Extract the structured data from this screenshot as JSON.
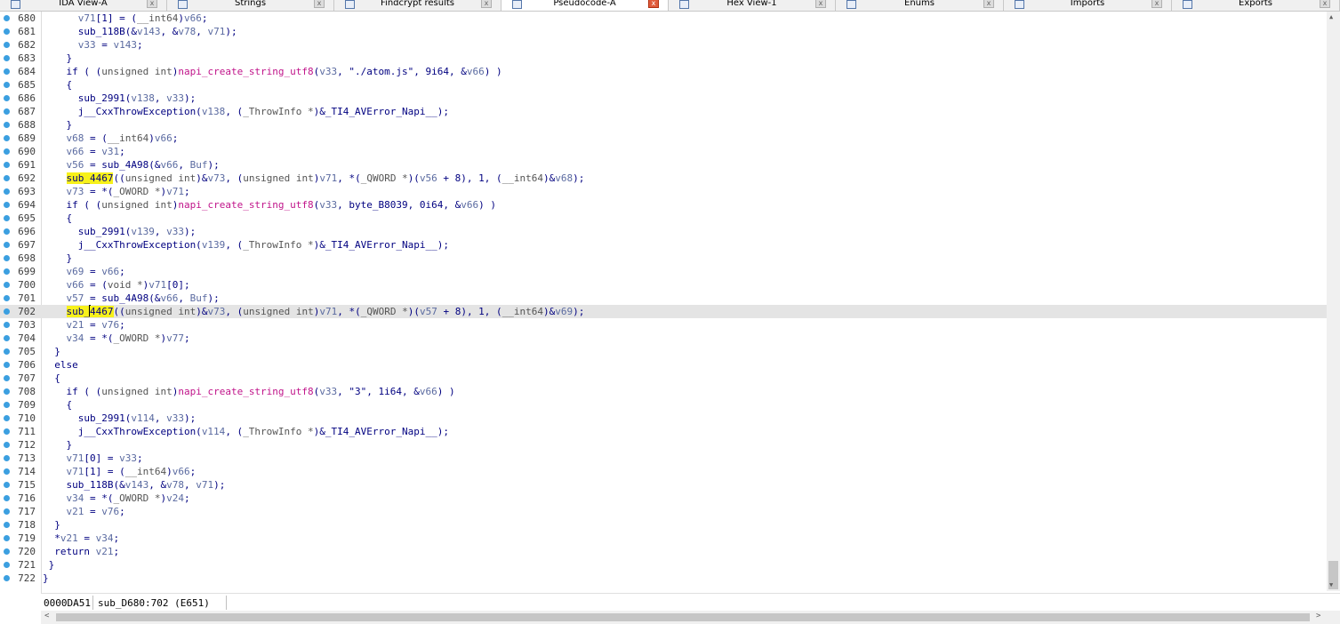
{
  "tabs": [
    {
      "label": "IDA View-A",
      "width": 188,
      "active": false,
      "icon": "disassembly-icon"
    },
    {
      "label": "Strings",
      "width": 188,
      "active": false,
      "icon": "strings-icon"
    },
    {
      "label": "Findcrypt results",
      "width": 188,
      "active": false,
      "icon": "findcrypt-icon"
    },
    {
      "label": "Pseudocode-A",
      "width": 188,
      "active": true,
      "icon": "pseudocode-icon"
    },
    {
      "label": "Hex View-1",
      "width": 188,
      "active": false,
      "icon": "hex-view-icon"
    },
    {
      "label": "Enums",
      "width": 189,
      "active": false,
      "icon": "enums-icon"
    },
    {
      "label": "Imports",
      "width": 189,
      "active": false,
      "icon": "imports-icon"
    },
    {
      "label": "Exports",
      "width": 189,
      "active": false,
      "icon": "exports-icon"
    }
  ],
  "close_glyph": "x",
  "code_lines": [
    {
      "n": "680",
      "s": [
        [
          "      ",
          ""
        ],
        [
          "v71",
          "var"
        ],
        [
          "[1] = (",
          ""
        ],
        [
          "__int64",
          "ty"
        ],
        [
          ")",
          ""
        ],
        [
          "v66",
          "var"
        ],
        [
          ";",
          ""
        ]
      ]
    },
    {
      "n": "681",
      "s": [
        [
          "      sub_118B(&",
          ""
        ],
        [
          "v143",
          "var"
        ],
        [
          ", &",
          ""
        ],
        [
          "v78",
          "var"
        ],
        [
          ", ",
          ""
        ],
        [
          "v71",
          "var"
        ],
        [
          ");",
          ""
        ]
      ]
    },
    {
      "n": "682",
      "s": [
        [
          "      ",
          ""
        ],
        [
          "v33",
          "var"
        ],
        [
          " = ",
          ""
        ],
        [
          "v143",
          "var"
        ],
        [
          ";",
          ""
        ]
      ]
    },
    {
      "n": "683",
      "s": [
        [
          "    }",
          ""
        ]
      ]
    },
    {
      "n": "684",
      "s": [
        [
          "    if ( (",
          ""
        ],
        [
          "unsigned int",
          "ty"
        ],
        [
          ")",
          ""
        ],
        [
          "napi_create_string_utf8",
          "fn"
        ],
        [
          "(",
          ""
        ],
        [
          "v33",
          "var"
        ],
        [
          ", \"./atom.js\", 9i64, &",
          ""
        ],
        [
          "v66",
          "var"
        ],
        [
          ") )",
          ""
        ]
      ]
    },
    {
      "n": "685",
      "s": [
        [
          "    {",
          ""
        ]
      ]
    },
    {
      "n": "686",
      "s": [
        [
          "      sub_2991(",
          ""
        ],
        [
          "v138",
          "var"
        ],
        [
          ", ",
          ""
        ],
        [
          "v33",
          "var"
        ],
        [
          ");",
          ""
        ]
      ]
    },
    {
      "n": "687",
      "s": [
        [
          "      j__CxxThrowException(",
          ""
        ],
        [
          "v138",
          "var"
        ],
        [
          ", (",
          ""
        ],
        [
          "_ThrowInfo *",
          "ty"
        ],
        [
          ")&_TI4_AVError_Napi__);",
          ""
        ]
      ]
    },
    {
      "n": "688",
      "s": [
        [
          "    }",
          ""
        ]
      ]
    },
    {
      "n": "689",
      "s": [
        [
          "    ",
          ""
        ],
        [
          "v68",
          "var"
        ],
        [
          " = (",
          ""
        ],
        [
          "__int64",
          "ty"
        ],
        [
          ")",
          ""
        ],
        [
          "v66",
          "var"
        ],
        [
          ";",
          ""
        ]
      ]
    },
    {
      "n": "690",
      "s": [
        [
          "    ",
          ""
        ],
        [
          "v66",
          "var"
        ],
        [
          " = ",
          ""
        ],
        [
          "v31",
          "var"
        ],
        [
          ";",
          ""
        ]
      ]
    },
    {
      "n": "691",
      "s": [
        [
          "    ",
          ""
        ],
        [
          "v56",
          "var"
        ],
        [
          " = sub_4A98(&",
          ""
        ],
        [
          "v66",
          "var"
        ],
        [
          ", ",
          ""
        ],
        [
          "Buf",
          "var"
        ],
        [
          ");",
          ""
        ]
      ]
    },
    {
      "n": "692",
      "s": [
        [
          "    ",
          ""
        ],
        [
          "sub_4467",
          "hl"
        ],
        [
          "((",
          ""
        ],
        [
          "unsigned int",
          "ty"
        ],
        [
          ")&",
          ""
        ],
        [
          "v73",
          "var"
        ],
        [
          ", (",
          ""
        ],
        [
          "unsigned int",
          "ty"
        ],
        [
          ")",
          ""
        ],
        [
          "v71",
          "var"
        ],
        [
          ", *(",
          ""
        ],
        [
          "_QWORD *",
          "ty"
        ],
        [
          ")(",
          ""
        ],
        [
          "v56",
          "var"
        ],
        [
          " + 8), 1, (",
          ""
        ],
        [
          "__int64",
          "ty"
        ],
        [
          ")&",
          ""
        ],
        [
          "v68",
          "var"
        ],
        [
          ");",
          ""
        ]
      ]
    },
    {
      "n": "693",
      "s": [
        [
          "    ",
          ""
        ],
        [
          "v73",
          "var"
        ],
        [
          " = *(",
          ""
        ],
        [
          "_OWORD *",
          "ty"
        ],
        [
          ")",
          ""
        ],
        [
          "v71",
          "var"
        ],
        [
          ";",
          ""
        ]
      ]
    },
    {
      "n": "694",
      "s": [
        [
          "    if ( (",
          ""
        ],
        [
          "unsigned int",
          "ty"
        ],
        [
          ")",
          ""
        ],
        [
          "napi_create_string_utf8",
          "fn"
        ],
        [
          "(",
          ""
        ],
        [
          "v33",
          "var"
        ],
        [
          ", byte_B8039, 0i64, &",
          ""
        ],
        [
          "v66",
          "var"
        ],
        [
          ") )",
          ""
        ]
      ]
    },
    {
      "n": "695",
      "s": [
        [
          "    {",
          ""
        ]
      ]
    },
    {
      "n": "696",
      "s": [
        [
          "      sub_2991(",
          ""
        ],
        [
          "v139",
          "var"
        ],
        [
          ", ",
          ""
        ],
        [
          "v33",
          "var"
        ],
        [
          ");",
          ""
        ]
      ]
    },
    {
      "n": "697",
      "s": [
        [
          "      j__CxxThrowException(",
          ""
        ],
        [
          "v139",
          "var"
        ],
        [
          ", (",
          ""
        ],
        [
          "_ThrowInfo *",
          "ty"
        ],
        [
          ")&_TI4_AVError_Napi__);",
          ""
        ]
      ]
    },
    {
      "n": "698",
      "s": [
        [
          "    }",
          ""
        ]
      ]
    },
    {
      "n": "699",
      "s": [
        [
          "    ",
          ""
        ],
        [
          "v69",
          "var"
        ],
        [
          " = ",
          ""
        ],
        [
          "v66",
          "var"
        ],
        [
          ";",
          ""
        ]
      ]
    },
    {
      "n": "700",
      "s": [
        [
          "    ",
          ""
        ],
        [
          "v66",
          "var"
        ],
        [
          " = (",
          ""
        ],
        [
          "void *",
          "ty"
        ],
        [
          ")",
          ""
        ],
        [
          "v71",
          "var"
        ],
        [
          "[0];",
          ""
        ]
      ]
    },
    {
      "n": "701",
      "s": [
        [
          "    ",
          ""
        ],
        [
          "v57",
          "var"
        ],
        [
          " = sub_4A98(&",
          ""
        ],
        [
          "v66",
          "var"
        ],
        [
          ", ",
          ""
        ],
        [
          "Buf",
          "var"
        ],
        [
          ");",
          ""
        ]
      ]
    },
    {
      "n": "702",
      "current": true,
      "s": [
        [
          "    ",
          ""
        ],
        [
          "sub_",
          "hl"
        ],
        [
          "|",
          "caret"
        ],
        [
          "4467",
          "hl"
        ],
        [
          "((",
          ""
        ],
        [
          "unsigned int",
          "ty"
        ],
        [
          ")&",
          ""
        ],
        [
          "v73",
          "var"
        ],
        [
          ", (",
          ""
        ],
        [
          "unsigned int",
          "ty"
        ],
        [
          ")",
          ""
        ],
        [
          "v71",
          "var"
        ],
        [
          ", *(",
          ""
        ],
        [
          "_QWORD *",
          "ty"
        ],
        [
          ")(",
          ""
        ],
        [
          "v57",
          "var"
        ],
        [
          " + 8), 1, (",
          ""
        ],
        [
          "__int64",
          "ty"
        ],
        [
          ")&",
          ""
        ],
        [
          "v69",
          "var"
        ],
        [
          ");",
          ""
        ]
      ]
    },
    {
      "n": "703",
      "s": [
        [
          "    ",
          ""
        ],
        [
          "v21",
          "var"
        ],
        [
          " = ",
          ""
        ],
        [
          "v76",
          "var"
        ],
        [
          ";",
          ""
        ]
      ]
    },
    {
      "n": "704",
      "s": [
        [
          "    ",
          ""
        ],
        [
          "v34",
          "var"
        ],
        [
          " = *(",
          ""
        ],
        [
          "_OWORD *",
          "ty"
        ],
        [
          ")",
          ""
        ],
        [
          "v77",
          "var"
        ],
        [
          ";",
          ""
        ]
      ]
    },
    {
      "n": "705",
      "s": [
        [
          "  }",
          ""
        ]
      ]
    },
    {
      "n": "706",
      "s": [
        [
          "  else",
          ""
        ]
      ]
    },
    {
      "n": "707",
      "s": [
        [
          "  {",
          ""
        ]
      ]
    },
    {
      "n": "708",
      "s": [
        [
          "    if ( (",
          ""
        ],
        [
          "unsigned int",
          "ty"
        ],
        [
          ")",
          ""
        ],
        [
          "napi_create_string_utf8",
          "fn"
        ],
        [
          "(",
          ""
        ],
        [
          "v33",
          "var"
        ],
        [
          ", \"3\", 1i64, &",
          ""
        ],
        [
          "v66",
          "var"
        ],
        [
          ") )",
          ""
        ]
      ]
    },
    {
      "n": "709",
      "s": [
        [
          "    {",
          ""
        ]
      ]
    },
    {
      "n": "710",
      "s": [
        [
          "      sub_2991(",
          ""
        ],
        [
          "v114",
          "var"
        ],
        [
          ", ",
          ""
        ],
        [
          "v33",
          "var"
        ],
        [
          ");",
          ""
        ]
      ]
    },
    {
      "n": "711",
      "s": [
        [
          "      j__CxxThrowException(",
          ""
        ],
        [
          "v114",
          "var"
        ],
        [
          ", (",
          ""
        ],
        [
          "_ThrowInfo *",
          "ty"
        ],
        [
          ")&_TI4_AVError_Napi__);",
          ""
        ]
      ]
    },
    {
      "n": "712",
      "s": [
        [
          "    }",
          ""
        ]
      ]
    },
    {
      "n": "713",
      "s": [
        [
          "    ",
          ""
        ],
        [
          "v71",
          "var"
        ],
        [
          "[0] = ",
          ""
        ],
        [
          "v33",
          "var"
        ],
        [
          ";",
          ""
        ]
      ]
    },
    {
      "n": "714",
      "s": [
        [
          "    ",
          ""
        ],
        [
          "v71",
          "var"
        ],
        [
          "[1] = (",
          ""
        ],
        [
          "__int64",
          "ty"
        ],
        [
          ")",
          ""
        ],
        [
          "v66",
          "var"
        ],
        [
          ";",
          ""
        ]
      ]
    },
    {
      "n": "715",
      "s": [
        [
          "    sub_118B(&",
          ""
        ],
        [
          "v143",
          "var"
        ],
        [
          ", &",
          ""
        ],
        [
          "v78",
          "var"
        ],
        [
          ", ",
          ""
        ],
        [
          "v71",
          "var"
        ],
        [
          ");",
          ""
        ]
      ]
    },
    {
      "n": "716",
      "s": [
        [
          "    ",
          ""
        ],
        [
          "v34",
          "var"
        ],
        [
          " = *(",
          ""
        ],
        [
          "_OWORD *",
          "ty"
        ],
        [
          ")",
          ""
        ],
        [
          "v24",
          "var"
        ],
        [
          ";",
          ""
        ]
      ]
    },
    {
      "n": "717",
      "s": [
        [
          "    ",
          ""
        ],
        [
          "v21",
          "var"
        ],
        [
          " = ",
          ""
        ],
        [
          "v76",
          "var"
        ],
        [
          ";",
          ""
        ]
      ]
    },
    {
      "n": "718",
      "s": [
        [
          "  }",
          ""
        ]
      ]
    },
    {
      "n": "719",
      "s": [
        [
          "  *",
          ""
        ],
        [
          "v21",
          "var"
        ],
        [
          " = ",
          ""
        ],
        [
          "v34",
          "var"
        ],
        [
          ";",
          ""
        ]
      ]
    },
    {
      "n": "720",
      "s": [
        [
          "  return ",
          ""
        ],
        [
          "v21",
          "var"
        ],
        [
          ";",
          ""
        ]
      ]
    },
    {
      "n": "721",
      "s": [
        [
          " }",
          ""
        ]
      ]
    },
    {
      "n": "722",
      "s": [
        [
          "}",
          ""
        ]
      ]
    }
  ],
  "status": {
    "address": "0000DA51",
    "function": "sub_D680:702 (E651)"
  },
  "scroll_arrows": {
    "up": "▲",
    "down": "▼",
    "left": "<",
    "right": ">"
  }
}
